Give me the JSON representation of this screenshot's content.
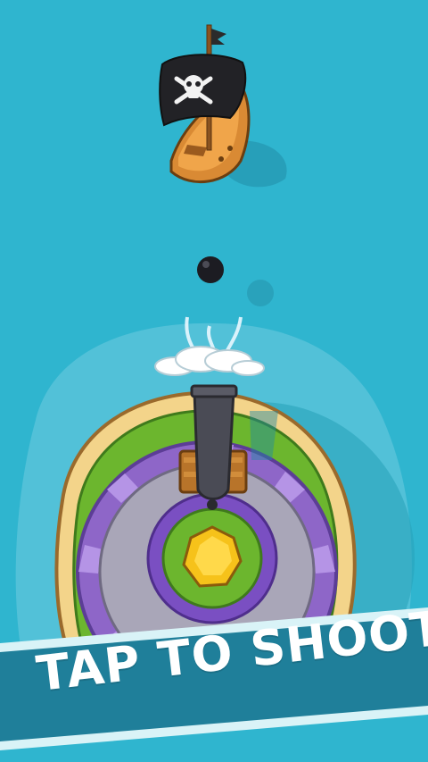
{
  "prompt": {
    "text": "TAP TO SHOOT"
  },
  "scene": {
    "sea_color": "#2fb5cf",
    "shallow_color": "#52c1d8",
    "banner_color": "#1f7f9a",
    "banner_edge_color": "#d9f3f7"
  },
  "sprites": {
    "enemy": "pirate-ship",
    "projectile": "cannonball",
    "player": "cannon",
    "treasure": "gold-gem",
    "flag": "skull-and-crossbones-icon"
  }
}
